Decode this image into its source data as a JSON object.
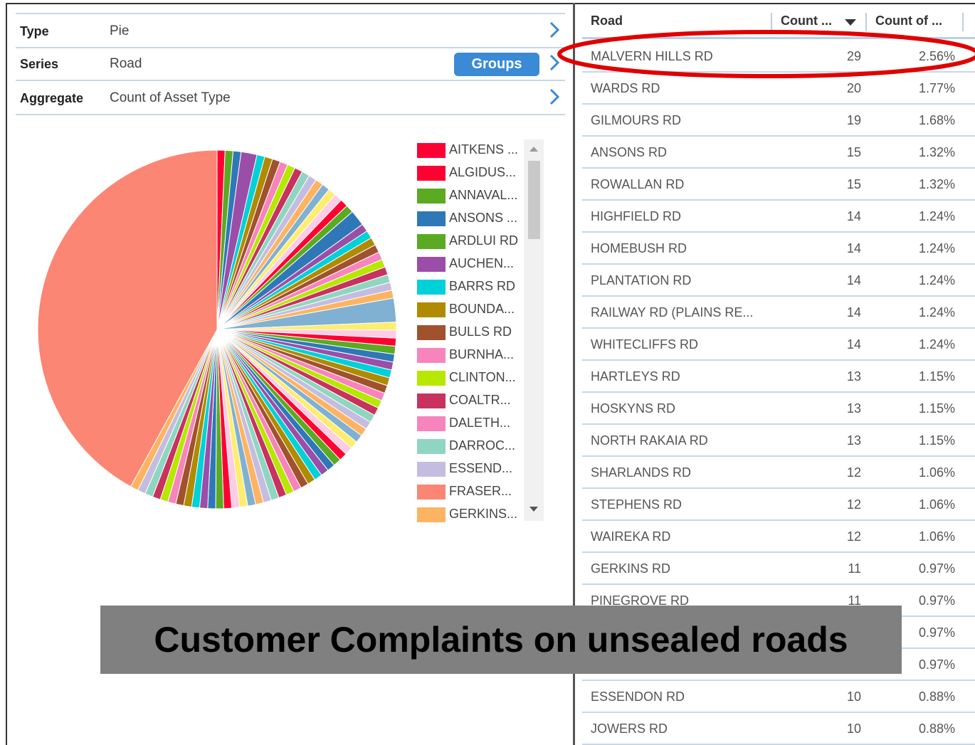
{
  "settings": {
    "type": {
      "key": "Type",
      "value": "Pie"
    },
    "series": {
      "key": "Series",
      "value": "Road",
      "button_label": "Groups"
    },
    "aggregate": {
      "key": "Aggregate",
      "value": "Count of Asset Type"
    }
  },
  "legend": {
    "items": [
      {
        "label": "AITKENS ...",
        "color": "#ff0033"
      },
      {
        "label": "ALGIDUS...",
        "color": "#ff0033"
      },
      {
        "label": "ANNAVAL...",
        "color": "#5aaa22"
      },
      {
        "label": "ANSONS ...",
        "color": "#2e78b8"
      },
      {
        "label": "ARDLUI RD",
        "color": "#5aaa22"
      },
      {
        "label": "AUCHEN...",
        "color": "#9b4ea8"
      },
      {
        "label": "BARRS RD",
        "color": "#00d0d8"
      },
      {
        "label": "BOUNDA...",
        "color": "#b08a00"
      },
      {
        "label": "BULLS RD",
        "color": "#a0522d"
      },
      {
        "label": "BURNHA...",
        "color": "#f784bd"
      },
      {
        "label": "CLINTON...",
        "color": "#b6e800"
      },
      {
        "label": "COALTR...",
        "color": "#c8325e"
      },
      {
        "label": "DALETH...",
        "color": "#f784bd"
      },
      {
        "label": "DARROC...",
        "color": "#8fd6c0"
      },
      {
        "label": "ESSEND...",
        "color": "#c5bde0"
      },
      {
        "label": "FRASER...",
        "color": "#fb8673"
      },
      {
        "label": "GERKINS...",
        "color": "#fdb462"
      }
    ]
  },
  "chart_data": {
    "type": "pie",
    "palette": [
      "#ff0033",
      "#5aaa22",
      "#2e78b8",
      "#9b4ea8",
      "#00d0d8",
      "#b08a00",
      "#a0522d",
      "#f784bd",
      "#b6e800",
      "#c8325e",
      "#8fd6c0",
      "#c5bde0",
      "#fdb462",
      "#80b1d3",
      "#ffed6f",
      "#fccde5"
    ],
    "dominant": {
      "label": "FRASER...",
      "color": "#fb8673",
      "share": 0.42
    },
    "other_slices": [
      1,
      1,
      1,
      2,
      1,
      1,
      1,
      1,
      1,
      1,
      1,
      1,
      1,
      1,
      1,
      1,
      1,
      1,
      2,
      1,
      1,
      1,
      1,
      1,
      1,
      1,
      1,
      1,
      1,
      3,
      1,
      1,
      1,
      1,
      1,
      1,
      1,
      1,
      1,
      1,
      1,
      1,
      1,
      1,
      1,
      1,
      1,
      1,
      1,
      1,
      1,
      1,
      1,
      1,
      1,
      1,
      1,
      1,
      1,
      1,
      1,
      1,
      1,
      1,
      1,
      1,
      1,
      1,
      1,
      1,
      1,
      1,
      1,
      1,
      1,
      1,
      1
    ]
  },
  "table": {
    "headers": {
      "road": "Road",
      "count": "Count ...",
      "pct": "Count of ..."
    },
    "rows": [
      {
        "road": "MALVERN HILLS RD",
        "count": "29",
        "pct": "2.56%"
      },
      {
        "road": "WARDS RD",
        "count": "20",
        "pct": "1.77%"
      },
      {
        "road": "GILMOURS RD",
        "count": "19",
        "pct": "1.68%"
      },
      {
        "road": "ANSONS RD",
        "count": "15",
        "pct": "1.32%"
      },
      {
        "road": "ROWALLAN RD",
        "count": "15",
        "pct": "1.32%"
      },
      {
        "road": "HIGHFIELD RD",
        "count": "14",
        "pct": "1.24%"
      },
      {
        "road": "HOMEBUSH RD",
        "count": "14",
        "pct": "1.24%"
      },
      {
        "road": "PLANTATION RD",
        "count": "14",
        "pct": "1.24%"
      },
      {
        "road": "RAILWAY RD (PLAINS RE...",
        "count": "14",
        "pct": "1.24%"
      },
      {
        "road": "WHITECLIFFS RD",
        "count": "14",
        "pct": "1.24%"
      },
      {
        "road": "HARTLEYS RD",
        "count": "13",
        "pct": "1.15%"
      },
      {
        "road": "HOSKYNS RD",
        "count": "13",
        "pct": "1.15%"
      },
      {
        "road": "NORTH RAKAIA RD",
        "count": "13",
        "pct": "1.15%"
      },
      {
        "road": "SHARLANDS RD",
        "count": "12",
        "pct": "1.06%"
      },
      {
        "road": "STEPHENS RD",
        "count": "12",
        "pct": "1.06%"
      },
      {
        "road": "WAIREKA RD",
        "count": "12",
        "pct": "1.06%"
      },
      {
        "road": "GERKINS RD",
        "count": "11",
        "pct": "0.97%"
      },
      {
        "road": "PINEGROVE RD",
        "count": "11",
        "pct": "0.97%"
      },
      {
        "road": "",
        "count": "",
        "pct": "0.97%"
      },
      {
        "road": "",
        "count": "",
        "pct": "0.97%"
      },
      {
        "road": "ESSENDON RD",
        "count": "10",
        "pct": "0.88%"
      },
      {
        "road": "JOWERS RD",
        "count": "10",
        "pct": "0.88%"
      }
    ]
  },
  "highlight_color": "#e00000",
  "caption": "Customer Complaints on unsealed roads"
}
